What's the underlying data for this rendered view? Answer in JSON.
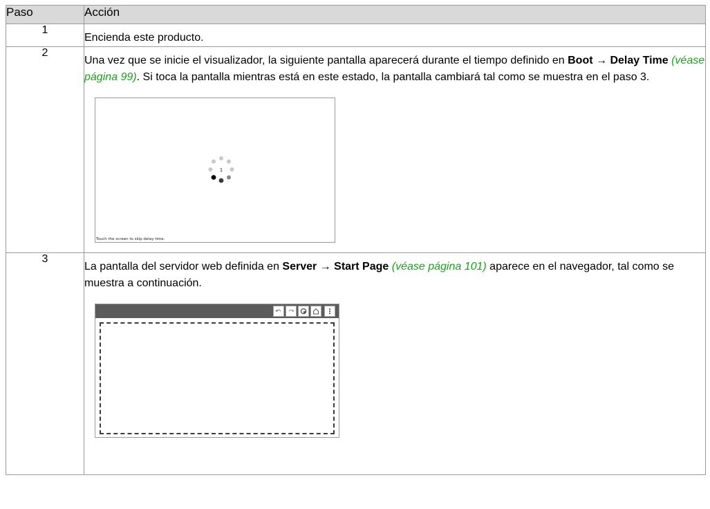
{
  "table": {
    "header": {
      "step": "Paso",
      "action": "Acción"
    },
    "rows": [
      {
        "step": "1",
        "text": "Encienda este producto."
      },
      {
        "step": "2",
        "text_1": "Una vez que se inicie el visualizador, la siguiente pantalla aparecerá durante el tiempo definido en ",
        "bold_1": "Boot",
        "arrow": " → ",
        "bold_2": "Delay Time",
        "link": "(véase página 99)",
        "text_2": ". Si toca la pantalla mientras está en este estado, la pantalla cambiará tal como se muestra en el paso 3.",
        "screen": {
          "spinner_number": "1",
          "caption": "Touch the screen to skip delay time."
        }
      },
      {
        "step": "3",
        "text_1": "La pantalla del servidor web definida en ",
        "bold_1": "Server",
        "arrow": " → ",
        "bold_2": "Start Page",
        "link": "(véase página 101)",
        "text_2": " aparece en el navegador, tal como se muestra a continuación.",
        "browser": {
          "toolbar_icons": [
            "back-icon",
            "forward-icon",
            "settings-icon",
            "home-icon",
            "more-icon"
          ]
        }
      }
    ]
  },
  "colors": {
    "link": "#1ba31b",
    "header_bg": "#d9d9d9",
    "browser_bar": "#5b5b5b"
  }
}
